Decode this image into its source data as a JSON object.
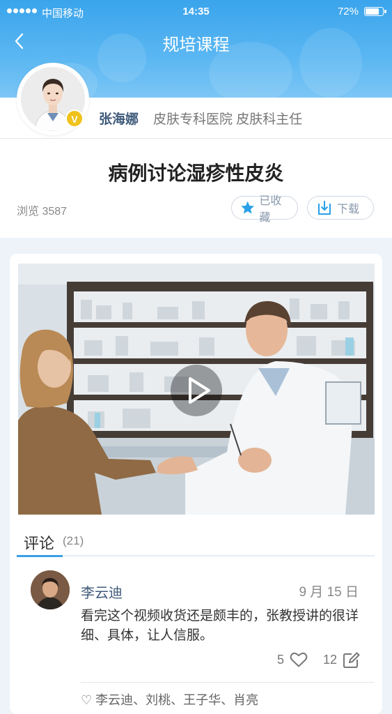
{
  "status_bar": {
    "carrier": "中国移动",
    "time": "14:35",
    "battery": "72%",
    "battery_level": 0.72
  },
  "nav": {
    "title": "规培课程",
    "back_icon": "chevron-left-icon"
  },
  "author": {
    "name": "张海娜",
    "title": "皮肤专科医院 皮肤科主任",
    "badge": "V",
    "badge_color": "#f0c21c"
  },
  "course": {
    "title": "病例讨论湿疹性皮炎",
    "views": "浏览 3587",
    "collect_label": "已收藏",
    "collect_icon": "star-icon",
    "download_label": "下载",
    "download_icon": "download-icon"
  },
  "video": {
    "play_icon": "play-icon"
  },
  "comments": {
    "tab_label": "评论",
    "count": "(21)",
    "items": [
      {
        "user": "李云迪",
        "date": "9 月 15 日",
        "text": "看完这个视频收货还是颇丰的，张教授讲的很详细、具体，让人信服。",
        "likes": "5",
        "replies": "12"
      }
    ],
    "sub_preview": "李云迪、刘桃、王子华、肖亮"
  },
  "colors": {
    "accent": "#3aa0e6",
    "header": "#4aafef",
    "name_text": "#3f5a7a",
    "star": "#29a0e8"
  }
}
